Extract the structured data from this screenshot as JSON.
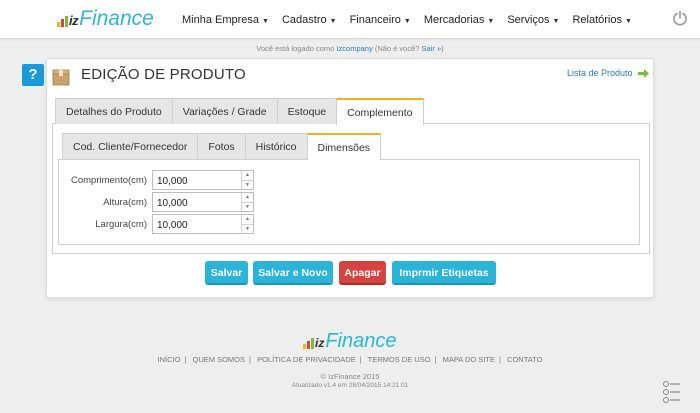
{
  "brand": {
    "iz": "iz",
    "name": "Finance",
    "bar_colors": [
      "#f0b31b",
      "#d6443f",
      "#7cbb3c"
    ]
  },
  "nav": {
    "items": [
      {
        "label": "Minha Empresa"
      },
      {
        "label": "Cadastro"
      },
      {
        "label": "Financeiro"
      },
      {
        "label": "Mercadorias"
      },
      {
        "label": "Serviços"
      },
      {
        "label": "Relatórios"
      }
    ],
    "caret": "▼"
  },
  "session": {
    "prefix": "Você está logado como",
    "user": "Izcompany",
    "not_you": "(Não é você?",
    "logout": "Sair »",
    "close": ")"
  },
  "page": {
    "help": "?",
    "title": "EDIÇÃO DE PRODUTO",
    "list_link": "Lista de Produto"
  },
  "tabs": [
    {
      "label": "Detalhes do Produto"
    },
    {
      "label": "Variações / Grade"
    },
    {
      "label": "Estoque"
    },
    {
      "label": "Complemento"
    }
  ],
  "subtabs": [
    {
      "label": "Cod. Cliente/Fornecedor"
    },
    {
      "label": "Fotos"
    },
    {
      "label": "Histórico"
    },
    {
      "label": "Dimensões"
    }
  ],
  "fields": {
    "comprimento": {
      "label": "Comprimento(cm)",
      "value": "10,000"
    },
    "altura": {
      "label": "Altura(cm)",
      "value": "10,000"
    },
    "largura": {
      "label": "Largura(cm)",
      "value": "10,000"
    }
  },
  "spin": {
    "up": "▲",
    "down": "▼"
  },
  "buttons": {
    "save": "Salvar",
    "save_new": "Salvar e Novo",
    "delete": "Apagar",
    "print": "Imprmir Etiquetas"
  },
  "footer": {
    "links": [
      {
        "label": "INÍCIO"
      },
      {
        "label": "QUEM SOMOS"
      },
      {
        "label": "POLÍTICA DE PRIVACIDADE"
      },
      {
        "label": "TERMOS DE USO"
      },
      {
        "label": "MAPA DO SITE"
      },
      {
        "label": "CONTATO"
      }
    ],
    "separator": "|",
    "copyright": "© IzFinance 2015",
    "updated": "Atualizado v1.4 em 28/04/2015 14:21:01"
  },
  "colors": {
    "accent": "#2bb4d8",
    "danger": "#d6443f",
    "tab_active": "#f0b31b",
    "link": "#2d79b5"
  }
}
